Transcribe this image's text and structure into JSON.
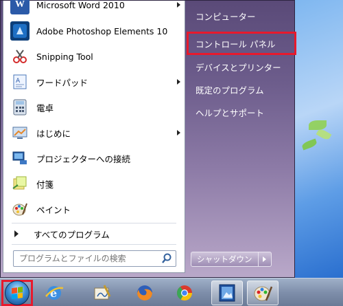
{
  "start_menu": {
    "programs": [
      {
        "label": "Microsoft Word 2010",
        "icon": "word-icon",
        "submenu": true
      },
      {
        "label": "Adobe Photoshop Elements 10",
        "icon": "photoshop-elements-icon",
        "submenu": false
      },
      {
        "label": "Snipping Tool",
        "icon": "scissors-icon",
        "submenu": false
      },
      {
        "label": "ワードパッド",
        "icon": "wordpad-icon",
        "submenu": true
      },
      {
        "label": "電卓",
        "icon": "calculator-icon",
        "submenu": false
      },
      {
        "label": "はじめに",
        "icon": "getting-started-icon",
        "submenu": true
      },
      {
        "label": "プロジェクターへの接続",
        "icon": "projector-icon",
        "submenu": false
      },
      {
        "label": "付箋",
        "icon": "sticky-notes-icon",
        "submenu": false
      },
      {
        "label": "ペイント",
        "icon": "paint-icon",
        "submenu": false
      }
    ],
    "all_programs_label": "すべてのプログラム",
    "search_placeholder": "プログラムとファイルの検索",
    "right_items": [
      {
        "label": "コンピューター"
      },
      {
        "label": "コントロール パネル"
      },
      {
        "label": "デバイスとプリンター"
      },
      {
        "label": "既定のプログラム"
      },
      {
        "label": "ヘルプとサポート"
      }
    ],
    "shutdown_label": "シャットダウン"
  },
  "taskbar": {
    "buttons": [
      "start-orb",
      "internet-explorer-icon",
      "handwriting-icon",
      "firefox-icon",
      "chrome-icon",
      "photo-viewer-icon",
      "paint-icon"
    ]
  },
  "colors": {
    "highlight": "#e8192c",
    "menu_panel": "#6d5d8c",
    "taskbar": "#7f8fab"
  }
}
